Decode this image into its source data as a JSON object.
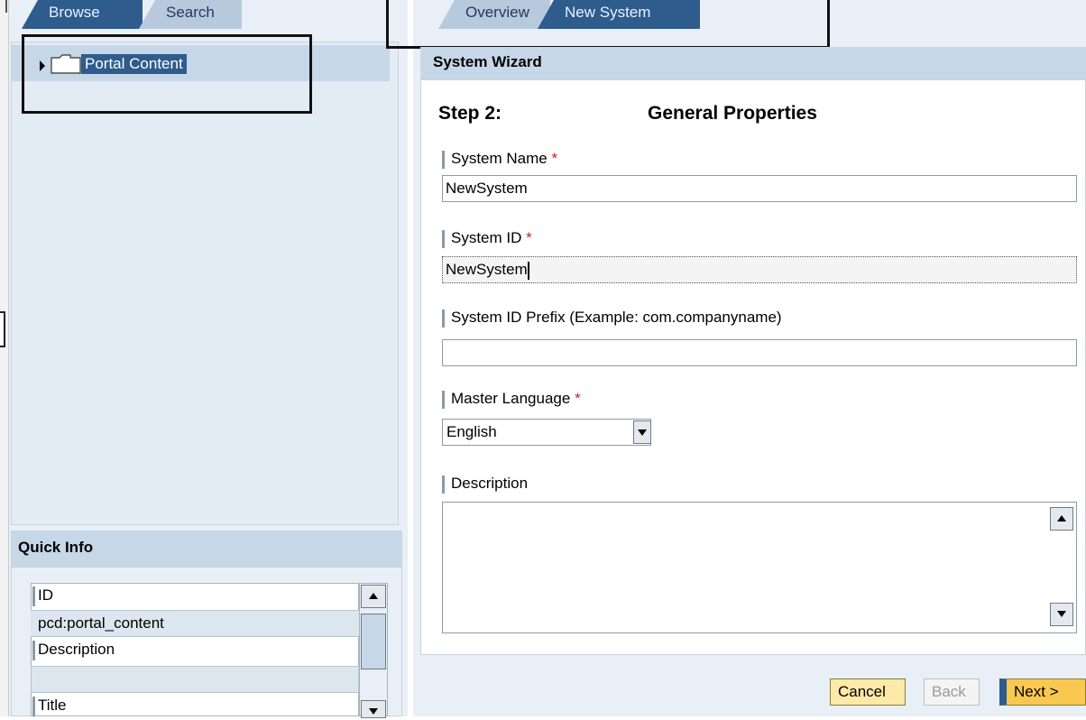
{
  "left_panel": {
    "tabs": [
      {
        "label": "Browse",
        "active": true
      },
      {
        "label": "Search",
        "active": false
      }
    ],
    "tree": {
      "items": [
        {
          "label": "Portal Content",
          "icon": "folder-icon",
          "expanded": false,
          "selected": true
        }
      ]
    },
    "quick_info": {
      "header": "Quick Info",
      "rows": [
        {
          "label": "ID"
        },
        {
          "value": "pcd:portal_content"
        },
        {
          "label": "Description"
        },
        {
          "value": ""
        },
        {
          "label": "Title"
        }
      ]
    }
  },
  "right_panel": {
    "tabs": [
      {
        "label": "Overview",
        "active": false
      },
      {
        "label": "New System",
        "active": true
      }
    ],
    "wizard": {
      "title": "System Wizard",
      "step_label": "Step 2:",
      "step_title": "General Properties",
      "fields": {
        "system_name": {
          "label": "System Name",
          "required": "*",
          "value": "NewSystem"
        },
        "system_id": {
          "label": "System ID",
          "required": "*",
          "value": "NewSystem"
        },
        "system_id_prefix": {
          "label": "System ID Prefix (Example: com.companyname)",
          "value": ""
        },
        "master_language": {
          "label": "Master Language",
          "required": "*",
          "value": "English"
        },
        "description": {
          "label": "Description",
          "value": ""
        }
      },
      "buttons": {
        "cancel": "Cancel",
        "back": "Back",
        "next": "Next >"
      }
    }
  },
  "colors": {
    "tab_active": "#2e5c8c",
    "tab_inactive": "#b7c9dd",
    "panel_header": "#c6d7e8",
    "primary_button": "#f9c850",
    "required_marker": "#cc2222"
  }
}
